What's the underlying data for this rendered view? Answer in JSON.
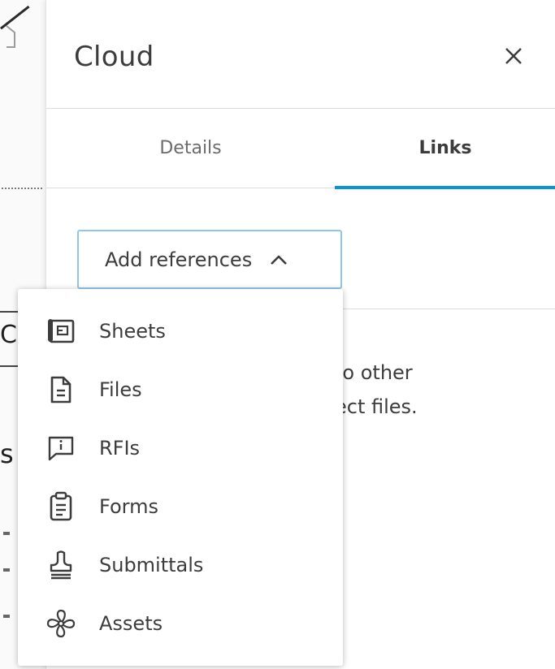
{
  "panel": {
    "title": "Cloud",
    "tabs": [
      {
        "label": "Details",
        "active": false
      },
      {
        "label": "Links",
        "active": true
      }
    ],
    "add_references_label": "Add references",
    "empty_text_line1": "to other",
    "empty_text_line2": "ect files."
  },
  "menu": {
    "items": [
      {
        "label": "Sheets",
        "icon": "sheets-icon"
      },
      {
        "label": "Files",
        "icon": "file-icon"
      },
      {
        "label": "RFIs",
        "icon": "rfi-icon"
      },
      {
        "label": "Forms",
        "icon": "forms-icon"
      },
      {
        "label": "Submittals",
        "icon": "stamp-icon"
      },
      {
        "label": "Assets",
        "icon": "fan-icon"
      }
    ]
  },
  "background": {
    "fragments": [
      "C",
      "s"
    ]
  },
  "colors": {
    "accent": "#0696d7",
    "button_border": "#91c6e6",
    "text": "#3c3c3c",
    "muted_text": "#6b6b6b",
    "divider": "#dcdcdc"
  }
}
